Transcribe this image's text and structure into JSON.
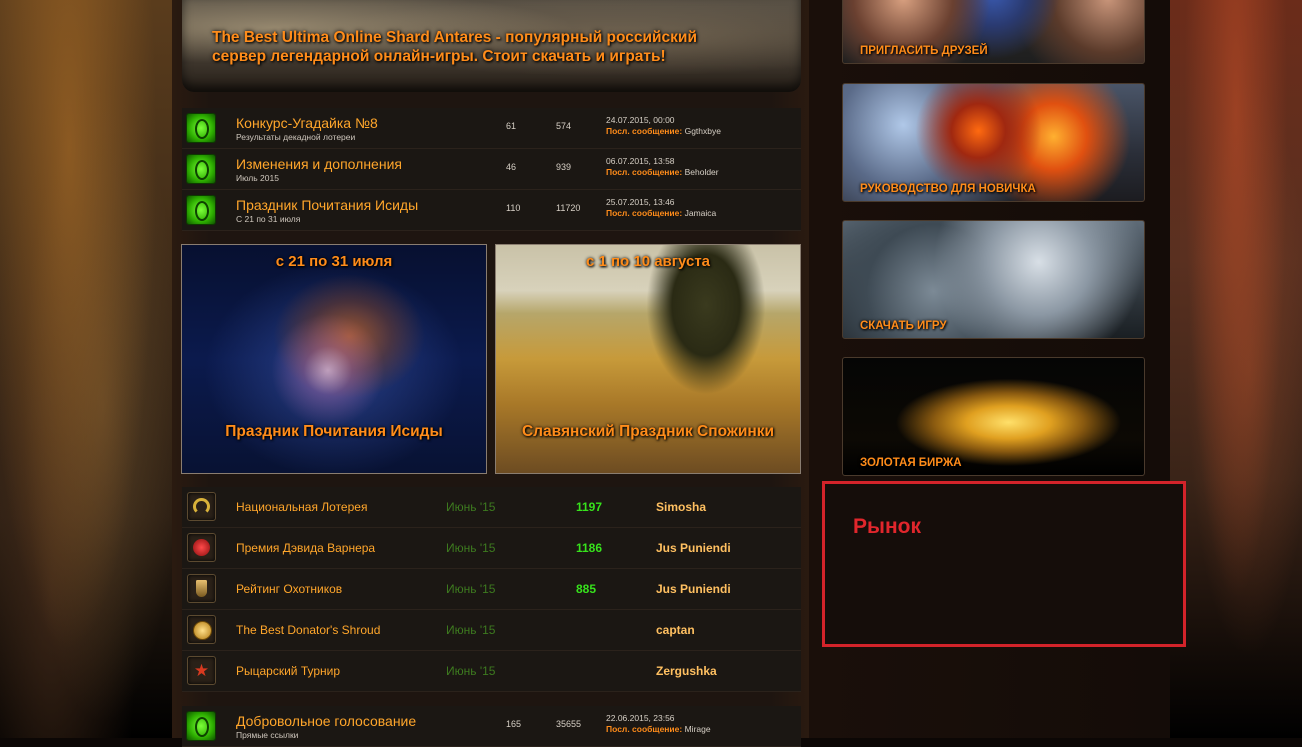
{
  "banner": {
    "text": "The Best Ultima Online Shard Antares - популярный российский сервер легендарной онлайн-игры. Стоит скачать и играть!"
  },
  "forums": [
    {
      "title": "Конкурс-Угадайка №8",
      "sub": "Результаты декадной лотереи",
      "topics": "61",
      "posts": "574",
      "date": "24.07.2015, 00:00",
      "last_label": "Посл. сообщение:",
      "last_user": "Ggthxbye",
      "icon": "forum-icon"
    },
    {
      "title": "Изменения и дополнения",
      "sub": "Июль 2015",
      "topics": "46",
      "posts": "939",
      "date": "06.07.2015, 13:58",
      "last_label": "Посл. сообщение:",
      "last_user": "Beholder",
      "icon": "forum-icon"
    },
    {
      "title": "Праздник Почитания Исиды",
      "sub": "С 21 по 31 июля",
      "topics": "110",
      "posts": "11720",
      "date": "25.07.2015, 13:46",
      "last_label": "Посл. сообщение:",
      "last_user": "Jamaica",
      "icon": "forum-icon"
    }
  ],
  "events": [
    {
      "dates": "с 21 по 31 июля",
      "name": "Праздник Почитания Исиды"
    },
    {
      "dates": "с 1 по 10 августа",
      "name": "Славянский Праздник Спожинки"
    }
  ],
  "awards": [
    {
      "name": "Национальная Лотерея",
      "month": "Июнь '15",
      "value": "1197",
      "winner": "Simosha",
      "icon": "horseshoe-icon",
      "color": "#d9b23a"
    },
    {
      "name": "Премия Дэвида Варнера",
      "month": "Июнь '15",
      "value": "1186",
      "winner": "Jus Puniendi",
      "icon": "flower-icon",
      "color": "#c21d1d"
    },
    {
      "name": "Рейтинг Охотников",
      "month": "Июнь '15",
      "value": "885",
      "winner": "Jus Puniendi",
      "icon": "trophy-icon",
      "color": "#c9a04a"
    },
    {
      "name": "The Best Donator's Shroud",
      "month": "Июнь '15",
      "value": "",
      "winner": "captan",
      "icon": "coin-icon",
      "color": "#e0b040"
    },
    {
      "name": "Рыцарский Турнир",
      "month": "Июнь '15",
      "value": "",
      "winner": "Zergushka",
      "icon": "star-icon",
      "color": "#c8301e"
    }
  ],
  "forum_bottom": {
    "title": "Добровольное голосование",
    "sub": "Прямые ссылки",
    "topics": "165",
    "posts": "35655",
    "date": "22.06.2015, 23:56",
    "last_label": "Посл. сообщение:",
    "last_user": "Mirage"
  },
  "sidebar": {
    "tiles": [
      {
        "label": "ПРИГЛАСИТЬ ДРУЗЕЙ"
      },
      {
        "label": "РУКОВОДСТВО ДЛЯ НОВИЧКА"
      },
      {
        "label": "СКАЧАТЬ ИГРУ"
      },
      {
        "label": "ЗОЛОТАЯ БИРЖА"
      }
    ],
    "market_title": "Рынок"
  },
  "colors": {
    "accent": "#ff8c1a",
    "green": "#37e21c",
    "highlight_border": "#d3232a"
  }
}
